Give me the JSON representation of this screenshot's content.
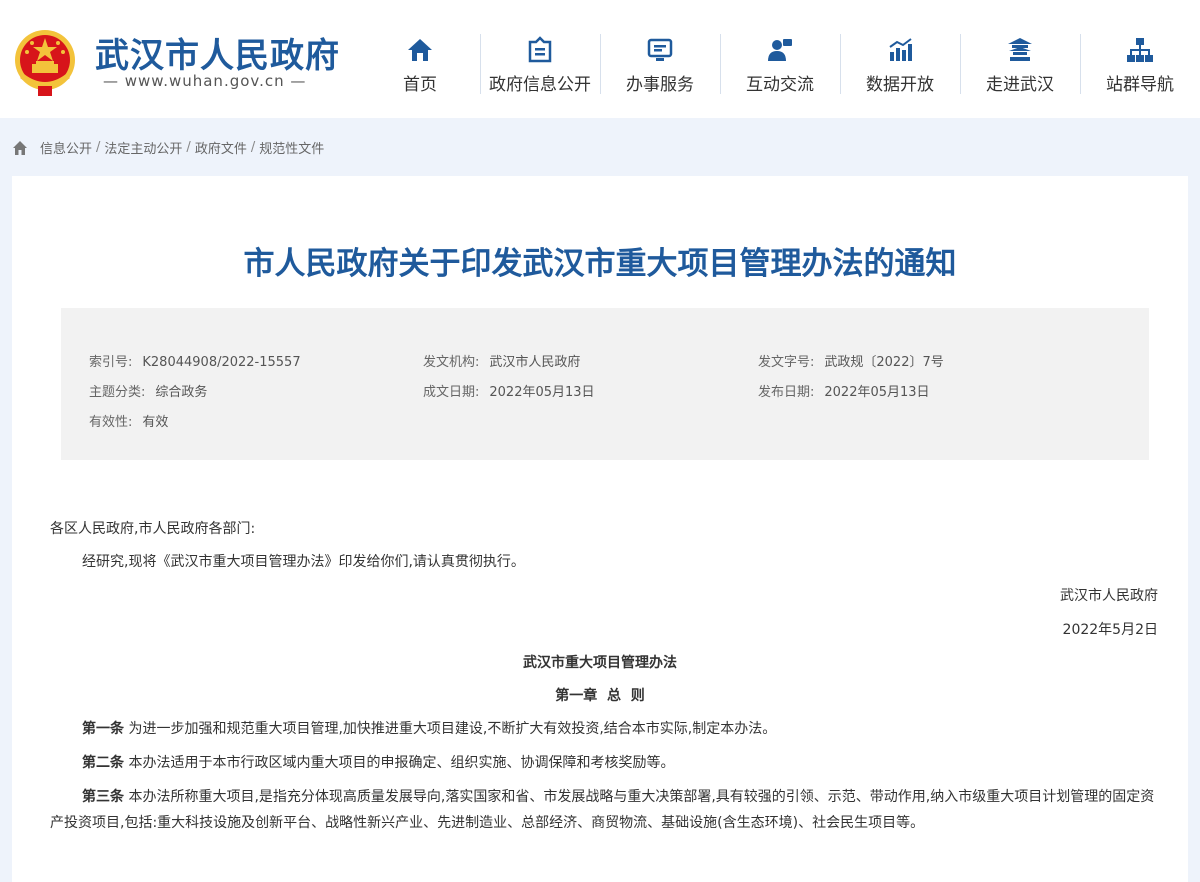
{
  "header": {
    "site_name": "武汉市人民政府",
    "site_domain": "— www.wuhan.gov.cn —",
    "nav": [
      {
        "label": "首页",
        "icon": "home-icon"
      },
      {
        "label": "政府信息公开",
        "icon": "info-open-icon"
      },
      {
        "label": "办事服务",
        "icon": "service-icon"
      },
      {
        "label": "互动交流",
        "icon": "interaction-icon"
      },
      {
        "label": "数据开放",
        "icon": "data-chart-icon"
      },
      {
        "label": "走进武汉",
        "icon": "landmark-icon"
      },
      {
        "label": "站群导航",
        "icon": "sitemap-icon"
      }
    ]
  },
  "breadcrumb": [
    "信息公开",
    "法定主动公开",
    "政府文件",
    "规范性文件"
  ],
  "document": {
    "title": "市人民政府关于印发武汉市重大项目管理办法的通知",
    "meta": {
      "index_no_label": "索引号:",
      "index_no": "K28044908/2022-15557",
      "issuer_label": "发文机构:",
      "issuer": "武汉市人民政府",
      "doc_no_label": "发文字号:",
      "doc_no": "武政规〔2022〕7号",
      "category_label": "主题分类:",
      "category": "综合政务",
      "created_label": "成文日期:",
      "created": "2022年05月13日",
      "published_label": "发布日期:",
      "published": "2022年05月13日",
      "validity_label": "有效性:",
      "validity": "有效"
    },
    "salutation": "各区人民政府,市人民政府各部门:",
    "intro": "经研究,现将《武汉市重大项目管理办法》印发给你们,请认真贯彻执行。",
    "signature": "武汉市人民政府",
    "sign_date": "2022年5月2日",
    "measures_title": "武汉市重大项目管理办法",
    "chapter_title": "第一章  总  则",
    "articles": [
      {
        "label": "第一条",
        "text": "为进一步加强和规范重大项目管理,加快推进重大项目建设,不断扩大有效投资,结合本市实际,制定本办法。"
      },
      {
        "label": "第二条",
        "text": "本办法适用于本市行政区域内重大项目的申报确定、组织实施、协调保障和考核奖励等。"
      },
      {
        "label": "第三条",
        "text": "本办法所称重大项目,是指充分体现高质量发展导向,落实国家和省、市发展战略与重大决策部署,具有较强的引领、示范、带动作用,纳入市级重大项目计划管理的固定资产投资项目,包括:重大科技设施及创新平台、战略性新兴产业、先进制造业、总部经济、商贸物流、基础设施(含生态环境)、社会民生项目等。"
      }
    ]
  },
  "colors": {
    "brand_blue": "#1f5a9c",
    "emblem_red": "#d7141a",
    "emblem_gold": "#f3c33b"
  }
}
